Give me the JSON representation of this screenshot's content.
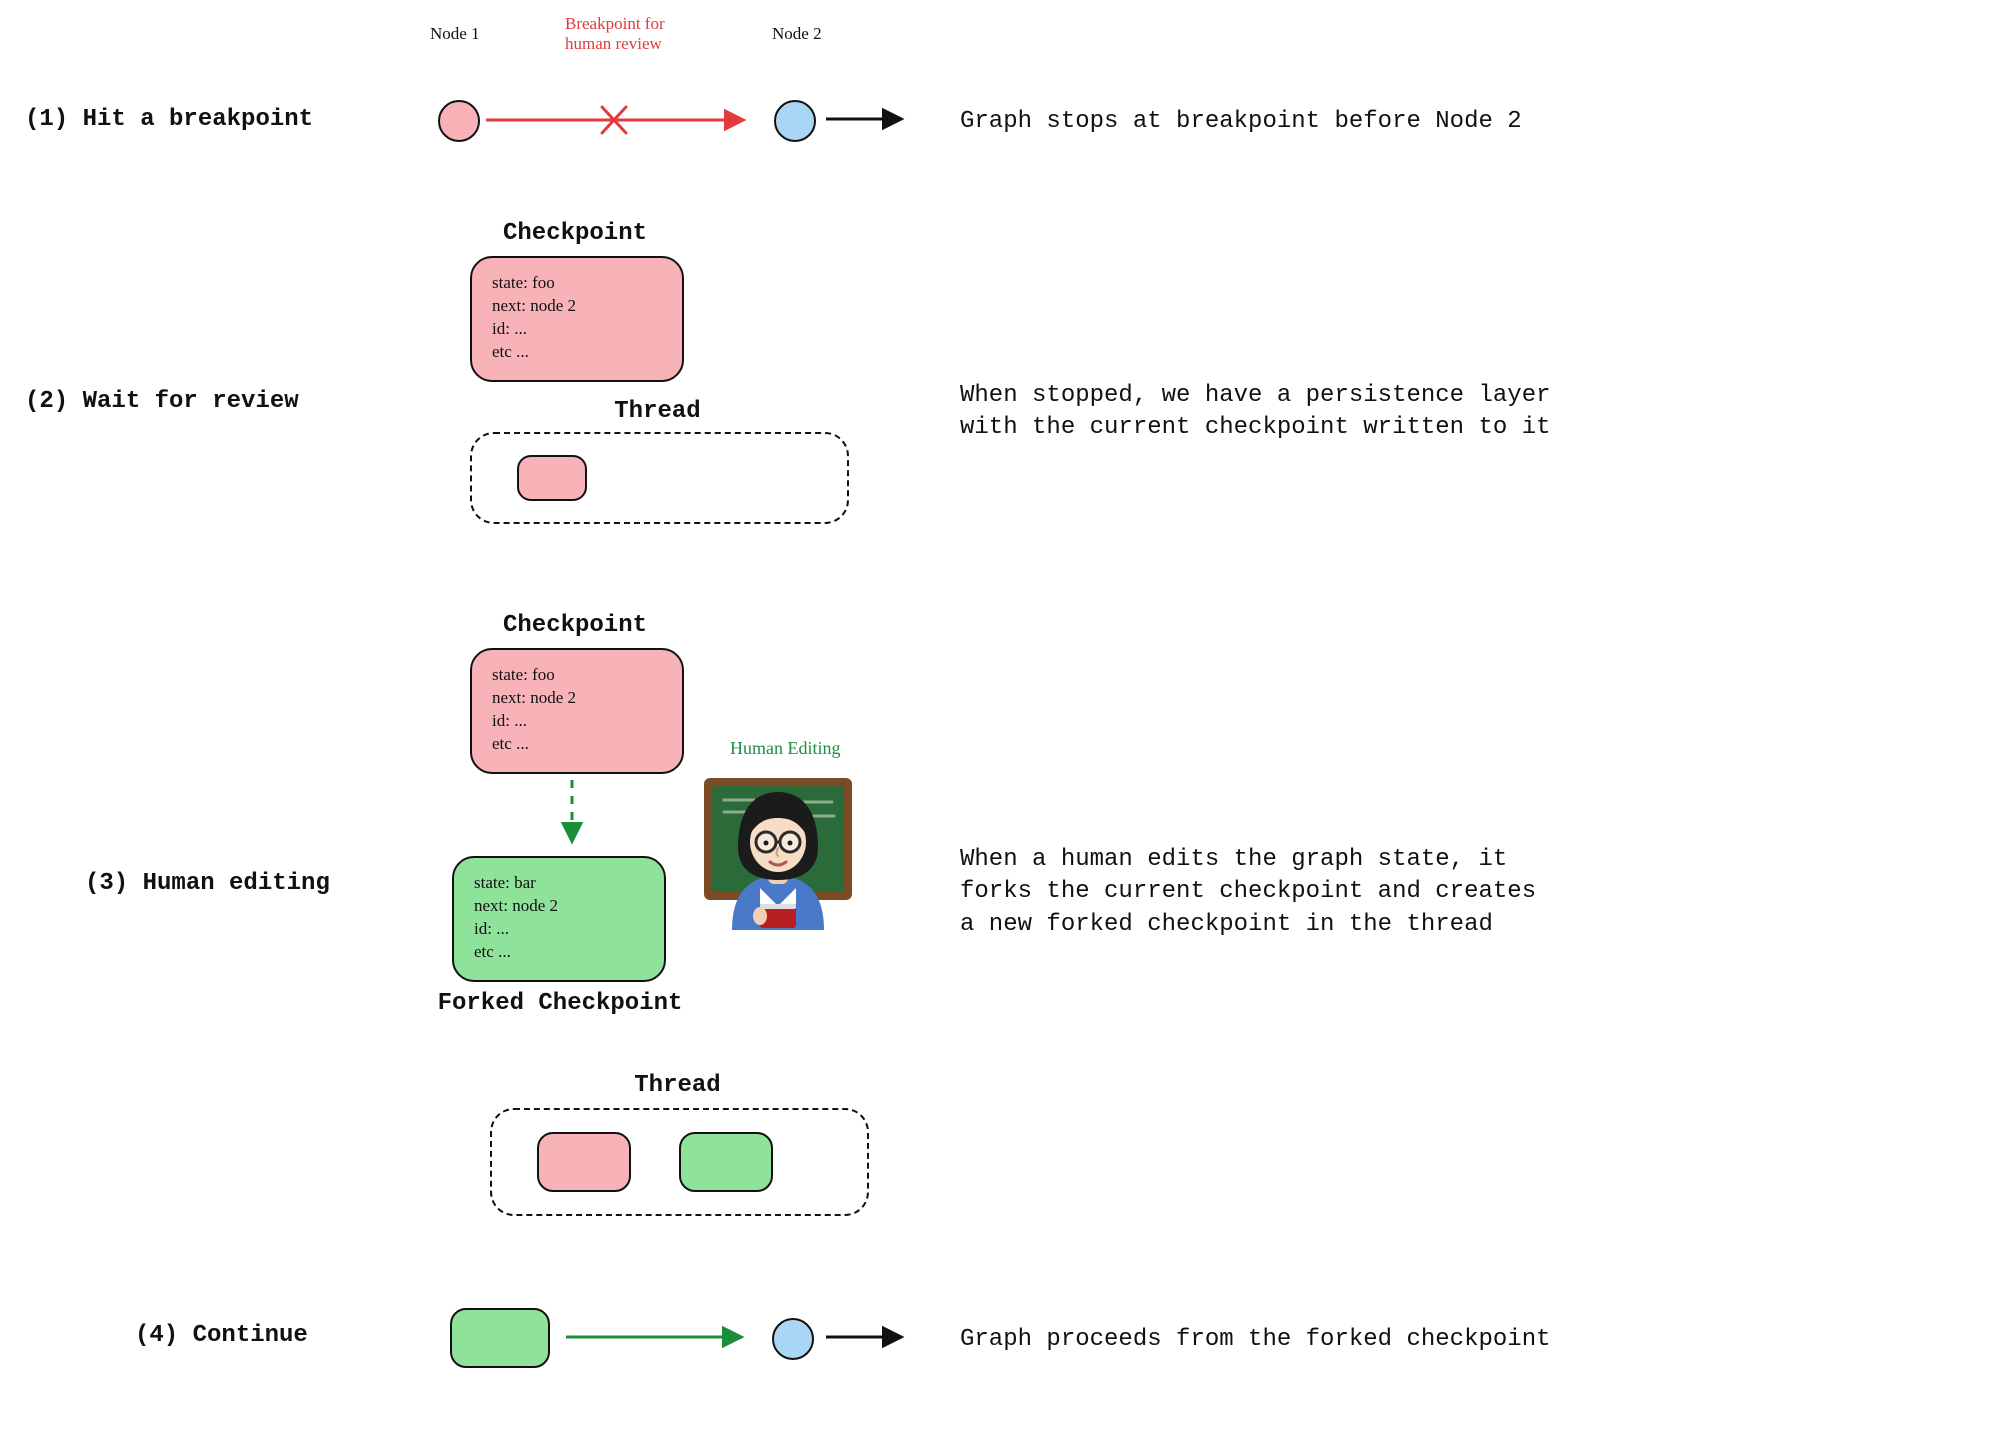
{
  "colors": {
    "pink": "#f7b3b7",
    "blue": "#a9d6f5",
    "green": "#8fe29a",
    "red": "#e23b3b",
    "hand_green": "#1a8f3b"
  },
  "step1": {
    "label": "(1) Hit a breakpoint",
    "node1_label": "Node 1",
    "node2_label": "Node 2",
    "breakpoint_label": "Breakpoint for\nhuman review",
    "description": "Graph stops at breakpoint before Node 2"
  },
  "step2": {
    "label": "(2) Wait for review",
    "checkpoint_title": "Checkpoint",
    "checkpoint_lines": [
      "state: foo",
      "next: node 2",
      "id: ...",
      "etc ..."
    ],
    "thread_title": "Thread",
    "description": "When stopped, we have a persistence layer\nwith the current checkpoint written to it"
  },
  "step3": {
    "label": "(3) Human editing",
    "checkpoint_title": "Checkpoint",
    "checkpoint_lines": [
      "state: foo",
      "next: node 2",
      "id: ...",
      "etc ..."
    ],
    "forked_title": "Forked Checkpoint",
    "forked_lines": [
      "state: bar",
      "next: node 2",
      "id: ...",
      "etc ..."
    ],
    "human_editing_label": "Human Editing",
    "thread_title": "Thread",
    "description": "When a human edits the graph state, it\nforks the current checkpoint and creates\na new forked checkpoint in the thread"
  },
  "step4": {
    "label": "(4) Continue",
    "description": "Graph proceeds from the forked checkpoint"
  }
}
